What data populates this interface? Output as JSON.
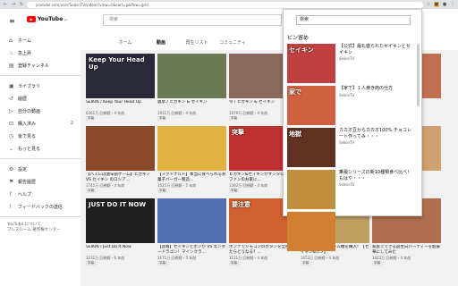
{
  "browser": {
    "url": "youtube.com/user/SeikinTV/videos?view=0&sort=p&flow=grid"
  },
  "header": {
    "logo": "YouTube",
    "region": "JP",
    "search_placeholder": "検索"
  },
  "sidebar": {
    "items": [
      {
        "icon": "home-icon",
        "glyph": "⌂",
        "label": "ホーム",
        "count": ""
      },
      {
        "icon": "trending-icon",
        "glyph": "♨",
        "label": "急上昇",
        "count": ""
      },
      {
        "icon": "subscriptions-icon",
        "glyph": "▤",
        "label": "登録チャンネル",
        "count": ""
      },
      {
        "icon": "library-icon",
        "glyph": "▣",
        "label": "ライブラリ",
        "count": ""
      },
      {
        "icon": "history-icon",
        "glyph": "↺",
        "label": "履歴",
        "count": ""
      },
      {
        "icon": "my-videos-icon",
        "glyph": "▷",
        "label": "自分の動画",
        "count": ""
      },
      {
        "icon": "purchases-icon",
        "glyph": "⊡",
        "label": "購入済み",
        "count": "2"
      },
      {
        "icon": "watch-later-icon",
        "glyph": "◷",
        "label": "後で見る",
        "count": ""
      },
      {
        "icon": "expand-icon",
        "glyph": "⌄",
        "label": "もっと見る",
        "count": ""
      },
      {
        "icon": "settings-icon",
        "glyph": "⚙",
        "label": "設定",
        "count": ""
      },
      {
        "icon": "report-history-icon",
        "glyph": "⚑",
        "label": "報告履歴",
        "count": ""
      },
      {
        "icon": "help-icon",
        "glyph": "?",
        "label": "ヘルプ",
        "count": ""
      },
      {
        "icon": "feedback-icon",
        "glyph": "!",
        "label": "フィードバックの送信",
        "count": ""
      }
    ],
    "footer": [
      "YouTube について",
      "プレスルーム 著作権センター"
    ]
  },
  "tabs": [
    "ホーム",
    "動画",
    "再生リスト",
    "コミュニティ"
  ],
  "videos": [
    {
      "title": "SEIKIN / Keep Your Head Up",
      "views": "6361万 回視聴・4 年前",
      "bg": "#2a2a3a",
      "caption": "Keep Your Head Up",
      "duration": ""
    },
    {
      "title": "雑草 / ヒカキン & セイキン",
      "views": "1931万 回視聴・4 年前",
      "bg": "#6b7a55",
      "caption": "",
      "duration": ""
    },
    {
      "title": "今 / ヒカキン & セイキン",
      "views": "1879万 回視聴・4 年前",
      "bg": "#8a6a5a",
      "caption": "",
      "duration": ""
    },
    {
      "title": "",
      "views": "",
      "bg": "#b08a6a",
      "caption": "",
      "duration": ""
    },
    {
      "title": "",
      "views": "",
      "bg": "#c07050",
      "caption": "",
      "duration": ""
    },
    {
      "title": "【ハズレは激辛罰ゲーム】ヒカキン VS セイキン のロシア...",
      "views": "1741万 回視聴・4 年前",
      "bg": "#8a4a2a",
      "caption": "",
      "duration": ""
    },
    {
      "title": "【マクドナルド】本当に食べられるお菓子バーガー製造...",
      "views": "1525万 回視聴・5 年前",
      "bg": "#e0b040",
      "caption": "",
      "duration": ""
    },
    {
      "title": "ヒカキン&セイキンがサンタになってファンのお家に...",
      "views": "1392万 回視聴・4 年前",
      "bg": "#c03030",
      "caption": "突撃",
      "duration": ""
    },
    {
      "title": "",
      "views": "",
      "bg": "#a05a3a",
      "caption": "",
      "duration": ""
    },
    {
      "title": "",
      "views": "",
      "bg": "#d0a070",
      "caption": "",
      "duration": ""
    },
    {
      "title": "SEIKIN / Just Do It Now",
      "views": "1231万 回視聴・6 年前",
      "bg": "#202020",
      "caption": "JUST DO IT NOW",
      "duration": ""
    },
    {
      "title": "【悲報】セイキンとポンが VS エンダードラゴン！マインクラ...",
      "views": "1171万 回視聴・4 年前",
      "bg": "#5070b0",
      "caption": "",
      "duration": ""
    },
    {
      "title": "ポンデでリモコンのボタンを全部押したらどうなる？...",
      "views": "1121万 回視聴・4 年前",
      "bg": "#d06030",
      "caption": "要注意",
      "duration": ""
    },
    {
      "title": "ハワイで超高級ゲーム機を購入！【セイキン&ポン】",
      "views": "1053万 回視聴・4 年前",
      "bg": "#c0a060",
      "caption": "",
      "duration": ""
    },
    {
      "title": "家庭でできる誕生日パーティーを超豪華にしてみた",
      "views": "1023万 回視聴・4 年前",
      "bg": "#b07050",
      "caption": "",
      "duration": ""
    }
  ],
  "popup": {
    "search_value": "検索",
    "heading": "ピン留め",
    "items": [
      {
        "title": "【公式】最も盛られたセイキンとセイキン",
        "channel": "SeikinTV",
        "bg": "#c04040",
        "caption": "セイキン"
      },
      {
        "title": "【家で】１人焼き肉の仕方",
        "channel": "SeikinTV",
        "bg": "#d06040",
        "caption": "家で"
      },
      {
        "title": "カカオ豆からカカオ100% チョコレート作ってみ・・・",
        "channel": "SeikinTV",
        "bg": "#603020",
        "caption": "地獄"
      },
      {
        "title": "乗最シリーズの新10種類食べ比べ！もはや・・・",
        "channel": "SeikinTV",
        "bg": "#c09040",
        "caption": ""
      },
      {
        "title": "",
        "channel": "",
        "bg": "#d08030",
        "caption": ""
      }
    ]
  }
}
